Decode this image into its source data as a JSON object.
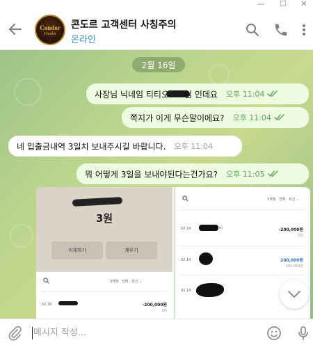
{
  "window": {
    "minimize_glyph": "—",
    "maximize_glyph": "☐",
    "close_glyph": "✕"
  },
  "header": {
    "title": "콘도르 고객센터 사칭주의",
    "status": "온라인",
    "avatar_text_top": "Condor",
    "avatar_text_bottom": "Condor",
    "status_color": "#3a8fd6",
    "icons": [
      "back-arrow-icon",
      "search-icon",
      "phone-icon",
      "more-vert-icon"
    ]
  },
  "chat": {
    "date": "2월 16일",
    "messages": [
      {
        "dir": "out",
        "text_before": "사장님 닉네임 티티오",
        "text_after": "님 인데요",
        "time": "오후 11:04",
        "read": true
      },
      {
        "dir": "out",
        "text": "쪽지가 이게 무슨말이에요?",
        "time": "오후 11:04",
        "read": true
      },
      {
        "dir": "in",
        "text": "네 입출금내역 3일치 보내주시길 바랍니다.",
        "time": "오후 11:04"
      },
      {
        "dir": "out",
        "text": "뭐 어떻게 3일을 보내야된다는건가요?",
        "time": "오후 11:05",
        "read": true
      }
    ],
    "media": {
      "left": {
        "amount": "3원",
        "buttons": [
          "이체하기",
          "채우기"
        ],
        "filter": "3개월 · 전체 · 최신 ⌄",
        "rows": [
          {
            "date": "02.16",
            "amount": "-200,000원",
            "sub": "3원"
          }
        ]
      },
      "right": {
        "filter": "3개월 · 전체 · 최신 ⌄",
        "rows": [
          {
            "date": "02.14",
            "name_tail": "e)",
            "amount": "-200,000원",
            "sub": "3원",
            "amount_color": "#222"
          },
          {
            "date": "02.14",
            "amount": "200,000원",
            "sub": "200,003원",
            "amount_color": "#2f6fd0"
          },
          {
            "date": "02.14",
            "amount": "",
            "sub": "",
            "amount_color": "#222"
          }
        ]
      }
    }
  },
  "composer": {
    "placeholder": "메시지 작성...",
    "icons": [
      "paperclip-icon",
      "emoji-icon",
      "microphone-icon"
    ]
  },
  "colors": {
    "outgoing_bubble": "#eefbe0",
    "incoming_bubble": "#ffffff",
    "read_check": "#59a85b",
    "accent": "#3a8fd6"
  }
}
